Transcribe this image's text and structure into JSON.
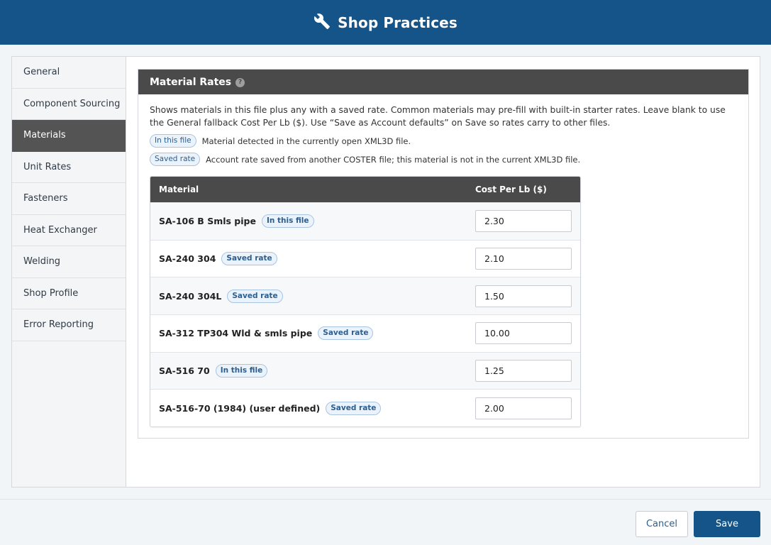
{
  "window": {
    "title": "Shop Practices",
    "icon": "wrench-icon"
  },
  "sidebar": {
    "items": [
      {
        "label": "General",
        "active": false
      },
      {
        "label": "Component Sourcing",
        "active": false
      },
      {
        "label": "Materials",
        "active": true
      },
      {
        "label": "Unit Rates",
        "active": false
      },
      {
        "label": "Fasteners",
        "active": false
      },
      {
        "label": "Heat Exchanger",
        "active": false
      },
      {
        "label": "Welding",
        "active": false
      },
      {
        "label": "Shop Profile",
        "active": false
      },
      {
        "label": "Error Reporting",
        "active": false
      }
    ]
  },
  "section": {
    "title": "Material Rates",
    "help_icon": "?",
    "description": "Shows materials in this file plus any with a saved rate. Common materials may pre-fill with built-in starter rates. Leave blank to use the General fallback Cost Per Lb ($). Use “Save as Account defaults” on Save so rates carry to other files.",
    "legend": [
      {
        "badge": "In this file",
        "text": "Material detected in the currently open XML3D file."
      },
      {
        "badge": "Saved rate",
        "text": "Account rate saved from another COSTER file; this material is not in the current XML3D file."
      }
    ]
  },
  "table": {
    "headers": {
      "material": "Material",
      "cost": "Cost Per Lb ($)"
    },
    "rows": [
      {
        "material": "SA-106 B Smls pipe",
        "badge": "In this file",
        "cost": "2.30"
      },
      {
        "material": "SA-240 304",
        "badge": "Saved rate",
        "cost": "2.10"
      },
      {
        "material": "SA-240 304L",
        "badge": "Saved rate",
        "cost": "1.50"
      },
      {
        "material": "SA-312 TP304 Wld & smls pipe",
        "badge": "Saved rate",
        "cost": "10.00"
      },
      {
        "material": "SA-516 70",
        "badge": "In this file",
        "cost": "1.25"
      },
      {
        "material": "SA-516-70 (1984) (user defined)",
        "badge": "Saved rate",
        "cost": "2.00"
      }
    ]
  },
  "footer": {
    "cancel_label": "Cancel",
    "save_label": "Save"
  },
  "colors": {
    "brand": "#145488",
    "header_dark": "#4a4a4a",
    "active_nav": "#545454",
    "badge_text": "#2c5e8e",
    "badge_bg": "#eaf2fb"
  }
}
